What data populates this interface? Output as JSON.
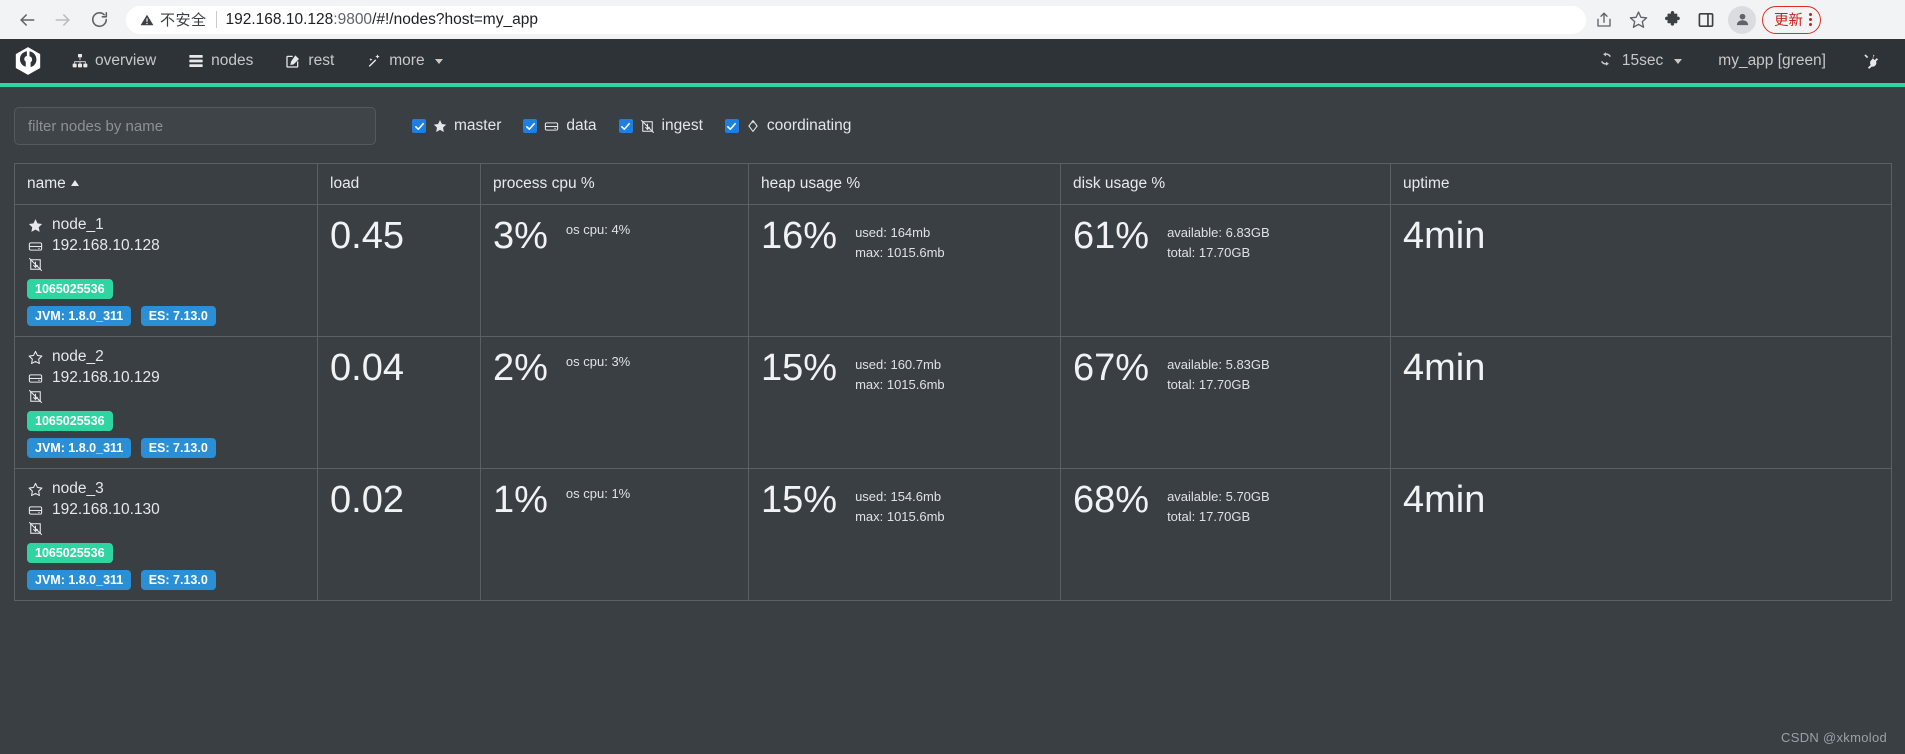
{
  "browser": {
    "back_icon": "arrow-left-icon",
    "forward_icon": "arrow-right-icon",
    "reload_icon": "reload-icon",
    "security_warning_icon": "warning-triangle-icon",
    "security_label": "不安全",
    "url_host": "192.168.10.128",
    "url_port": ":9800",
    "url_path": "/#!/nodes?host=my_app",
    "url_full": "192.168.10.128:9800/#!/nodes?host=my_app",
    "share_icon": "share-icon",
    "bookmark_icon": "star-outline-icon",
    "extensions_icon": "puzzle-piece-icon",
    "sidepanel_icon": "side-panel-icon",
    "profile_icon": "person-avatar-icon",
    "update_label": "更新",
    "menu_icon": "kebab-menu-icon"
  },
  "app_header": {
    "logo_icon": "cerebro-logo-icon",
    "nav": [
      {
        "label": "overview",
        "icon": "sitemap-icon"
      },
      {
        "label": "nodes",
        "icon": "server-list-icon"
      },
      {
        "label": "rest",
        "icon": "edit-square-icon"
      },
      {
        "label": "more",
        "icon": "magic-wand-icon",
        "has_caret": true
      }
    ],
    "refresh": {
      "icon": "refresh-cycle-icon",
      "label": "15sec",
      "has_caret": true
    },
    "cluster": "my_app [green]",
    "disconnect_icon": "plug-icon",
    "accent_color": "#2fd5a0"
  },
  "filters": {
    "search_placeholder": "filter nodes by name",
    "search_value": "",
    "roles": [
      {
        "label": "master",
        "icon": "star-filled-icon",
        "checked": true
      },
      {
        "label": "data",
        "icon": "database-disk-icon",
        "checked": true
      },
      {
        "label": "ingest",
        "icon": "ingest-arrow-icon",
        "checked": true
      },
      {
        "label": "coordinating",
        "icon": "diamond-icon",
        "checked": true
      }
    ]
  },
  "table": {
    "columns": [
      {
        "label": "name",
        "sorted": true,
        "sort_dir": "asc"
      },
      {
        "label": "load"
      },
      {
        "label": "process cpu %"
      },
      {
        "label": "heap usage %"
      },
      {
        "label": "disk usage %"
      },
      {
        "label": "uptime"
      }
    ],
    "rows": [
      {
        "name": "node_1",
        "master_icon": "star-filled-icon",
        "ip": "192.168.10.128",
        "ip_icon": "database-disk-icon",
        "ingest_icon": "ingest-arrow-icon",
        "id_badge": "1065025536",
        "jvm_badge": "JVM: 1.8.0_311",
        "es_badge": "ES: 7.13.0",
        "load": "0.45",
        "process_cpu": "3%",
        "os_cpu": "os cpu: 4%",
        "heap_pct": "16%",
        "heap_used": "used: 164mb",
        "heap_max": "max: 1015.6mb",
        "disk_pct": "61%",
        "disk_available": "available: 6.83GB",
        "disk_total": "total: 17.70GB",
        "uptime": "4min"
      },
      {
        "name": "node_2",
        "master_icon": "star-outline-icon",
        "ip": "192.168.10.129",
        "ip_icon": "database-disk-icon",
        "ingest_icon": "ingest-arrow-icon",
        "id_badge": "1065025536",
        "jvm_badge": "JVM: 1.8.0_311",
        "es_badge": "ES: 7.13.0",
        "load": "0.04",
        "process_cpu": "2%",
        "os_cpu": "os cpu: 3%",
        "heap_pct": "15%",
        "heap_used": "used: 160.7mb",
        "heap_max": "max: 1015.6mb",
        "disk_pct": "67%",
        "disk_available": "available: 5.83GB",
        "disk_total": "total: 17.70GB",
        "uptime": "4min"
      },
      {
        "name": "node_3",
        "master_icon": "star-outline-icon",
        "ip": "192.168.10.130",
        "ip_icon": "database-disk-icon",
        "ingest_icon": "ingest-arrow-icon",
        "id_badge": "1065025536",
        "jvm_badge": "JVM: 1.8.0_311",
        "es_badge": "ES: 7.13.0",
        "load": "0.02",
        "process_cpu": "1%",
        "os_cpu": "os cpu: 1%",
        "heap_pct": "15%",
        "heap_used": "used: 154.6mb",
        "heap_max": "max: 1015.6mb",
        "disk_pct": "68%",
        "disk_available": "available: 5.70GB",
        "disk_total": "total: 17.70GB",
        "uptime": "4min"
      }
    ]
  },
  "watermark": "CSDN @xkmolod"
}
